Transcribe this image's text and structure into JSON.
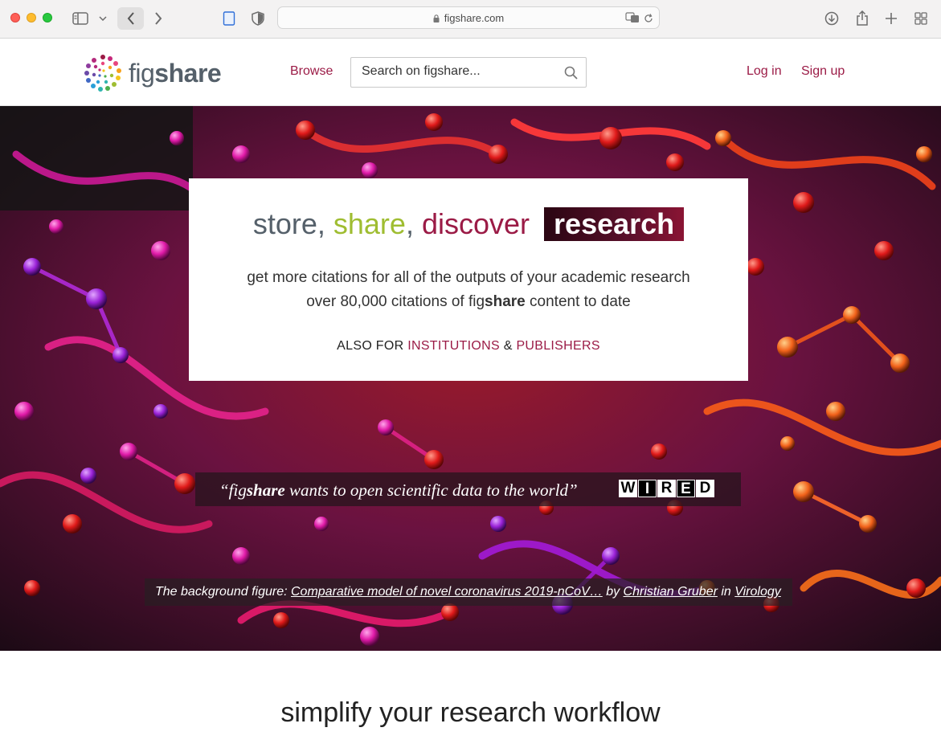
{
  "browser": {
    "url": "figshare.com"
  },
  "header": {
    "logo_light": "fig",
    "logo_bold": "share",
    "browse": "Browse",
    "search_placeholder": "Search on figshare...",
    "login": "Log in",
    "signup": "Sign up"
  },
  "hero": {
    "tagline": {
      "store": "store,",
      "share": "share",
      "comma": ",",
      "discover": "discover",
      "research": "research"
    },
    "sub1": "get more citations for all of the outputs of your academic research",
    "sub2_pre": "over 80,000 citations of fig",
    "sub2_bold": "share",
    "sub2_post": " content to date",
    "also_for": "ALSO FOR",
    "institutions": "INSTITUTIONS",
    "amp": "&",
    "publishers": "PUBLISHERS",
    "quote_pre": "“fig",
    "quote_bold": "share",
    "quote_post": " wants to open scientific data to the world”",
    "wired_letters": [
      "W",
      "I",
      "R",
      "E",
      "D"
    ],
    "credit_pre": "The background figure: ",
    "credit_link": "Comparative model of novel coronavirus 2019-nCoV…",
    "credit_by": " by ",
    "credit_author": "Christian Gruber",
    "credit_in": " in ",
    "credit_category": "Virology"
  },
  "section": {
    "title": "simplify your research workflow"
  },
  "colors": {
    "brand": "#9b1b46",
    "green": "#9fbd31",
    "grey": "#55606a"
  }
}
